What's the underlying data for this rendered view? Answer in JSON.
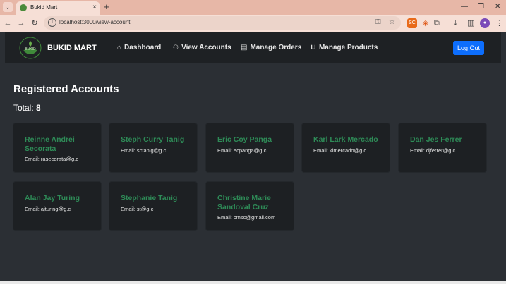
{
  "browser": {
    "tab_title": "Bukid Mart",
    "url": "localhost:3000/view-account",
    "ext_sc": "SC"
  },
  "nav": {
    "brand": "BUKID MART",
    "logo_text": "BUKID",
    "links": [
      "Dashboard",
      "View Accounts",
      "Manage Orders",
      "Manage Products"
    ],
    "logout": "Log Out"
  },
  "page": {
    "heading": "Registered Accounts",
    "total_label": "Total:",
    "total_value": "8"
  },
  "accounts": [
    {
      "name_line1": "Reinne Andrei",
      "name_line2": "Secorata",
      "email": "Email: rasecorata@g.c"
    },
    {
      "name_line1": "Steph Curry Tanig",
      "name_line2": "",
      "email": "Email: sctanig@g.c"
    },
    {
      "name_line1": "Eric Coy Panga",
      "name_line2": "",
      "email": "Email: ecpanga@g.c"
    },
    {
      "name_line1": "Karl Lark Mercado",
      "name_line2": "",
      "email": "Email: klmercado@g.c"
    },
    {
      "name_line1": "Dan Jes Ferrer",
      "name_line2": "",
      "email": "Email: djferrer@g.c"
    },
    {
      "name_line1": "Alan Jay Turing",
      "name_line2": "",
      "email": "Email: ajturing@g.c"
    },
    {
      "name_line1": "Stephanie Tanig",
      "name_line2": "",
      "email": "Email: st@g.c"
    },
    {
      "name_line1": "Christine Marie",
      "name_line2": "Sandoval Cruz",
      "email": "Email: cmsc@gmail.com"
    }
  ],
  "colors": {
    "accent_green": "#2e8b57",
    "logout_blue": "#0d6efd",
    "page_bg": "#2b2f34",
    "card_bg": "#1d2023"
  }
}
